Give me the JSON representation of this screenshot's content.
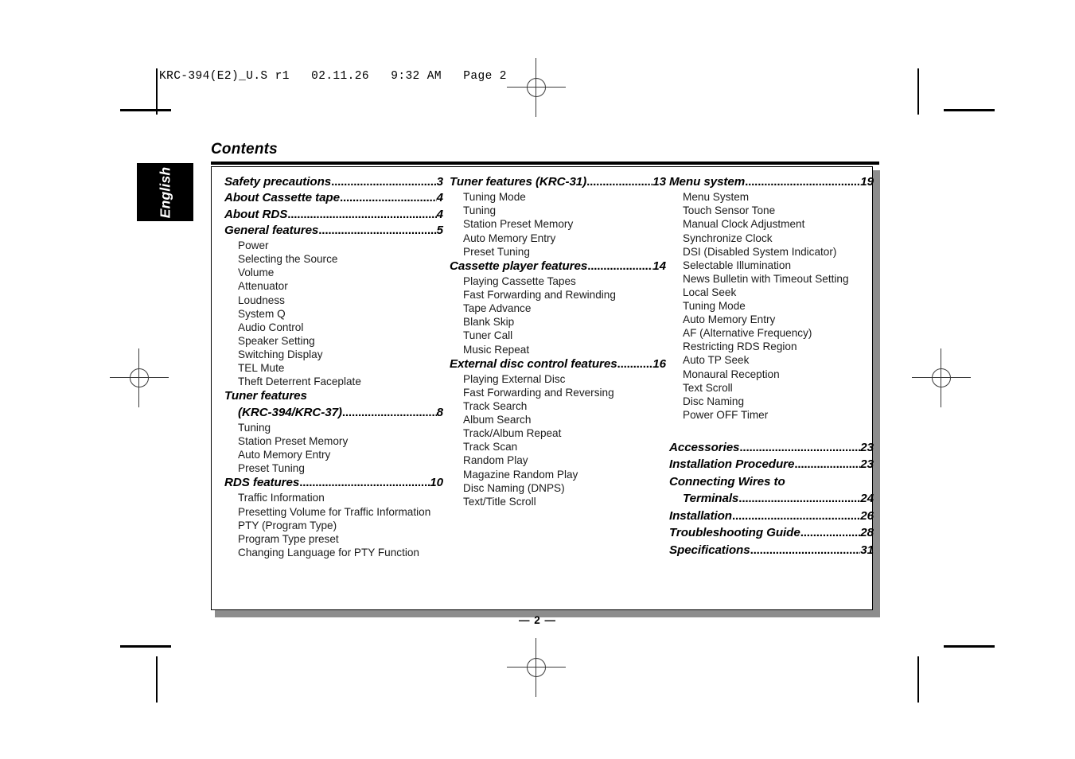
{
  "print_header": {
    "text": "KRC-394(E2)_U.S r1   02.11.26   9:32 AM   Page 2"
  },
  "language_tab": {
    "label": "English"
  },
  "page_title": "Contents",
  "footer": "— 2 —",
  "colors": {
    "frame": "#000000",
    "shadow": "#8d8d8d",
    "tab_background": "#000000",
    "tab_text": "#ffffff"
  },
  "columns": [
    {
      "sections": [
        {
          "title": "Safety precautions",
          "page": "3",
          "subitems": []
        },
        {
          "title": "About Cassette tape",
          "page": "4",
          "subitems": []
        },
        {
          "title": "About RDS",
          "page": "4",
          "subitems": []
        },
        {
          "title": "General features",
          "page": "5",
          "subitems": [
            "Power",
            "Selecting the Source",
            "Volume",
            "Attenuator",
            "Loudness",
            "System Q",
            "Audio Control",
            "Speaker Setting",
            "Switching Display",
            "TEL Mute",
            "Theft Deterrent Faceplate"
          ]
        },
        {
          "title": "Tuner features",
          "title_line2": "(KRC-394/KRC-37)",
          "page": "8",
          "subitems": [
            "Tuning",
            "Station Preset Memory",
            "Auto Memory Entry",
            "Preset Tuning"
          ]
        },
        {
          "title": "RDS features",
          "page": "10",
          "subitems": [
            "Traffic Information",
            "Presetting Volume for Traffic Information",
            "PTY (Program Type)",
            "Program Type preset",
            "Changing Language for PTY Function"
          ]
        }
      ]
    },
    {
      "sections": [
        {
          "title": "Tuner features (KRC-31)",
          "page": "13",
          "subitems": [
            "Tuning Mode",
            "Tuning",
            "Station Preset Memory",
            "Auto Memory Entry",
            "Preset Tuning"
          ]
        },
        {
          "title": "Cassette player features",
          "page": "14",
          "subitems": [
            "Playing Cassette Tapes",
            "Fast Forwarding and Rewinding",
            "Tape Advance",
            "Blank Skip",
            "Tuner Call",
            "Music Repeat"
          ]
        },
        {
          "title": "External disc control features",
          "page": "16",
          "subitems": [
            "Playing External Disc",
            "Fast Forwarding and Reversing",
            "Track Search",
            "Album Search",
            "Track/Album Repeat",
            "Track Scan",
            "Random Play",
            "Magazine Random Play",
            "Disc Naming (DNPS)",
            "Text/Title Scroll"
          ]
        }
      ]
    },
    {
      "sections": [
        {
          "title": "Menu system",
          "page": "19",
          "subitems": [
            "Menu System",
            "Touch Sensor Tone",
            "Manual Clock Adjustment",
            "Synchronize Clock",
            "DSI (Disabled System Indicator)",
            "Selectable Illumination",
            "News Bulletin with Timeout Setting",
            "Local Seek",
            "Tuning Mode",
            "Auto Memory Entry",
            "AF (Alternative Frequency)",
            "Restricting RDS Region",
            "Auto TP Seek",
            "Monaural Reception",
            "Text Scroll",
            "Disc Naming",
            "Power OFF Timer"
          ]
        }
      ],
      "tail_sections": [
        {
          "title": "Accessories",
          "page": "23",
          "subitems": []
        },
        {
          "title": "Installation Procedure",
          "page": "23",
          "subitems": []
        },
        {
          "title": "Connecting Wires to",
          "title_line2": "Terminals",
          "page": "24",
          "subitems": []
        },
        {
          "title": "Installation",
          "page": "26",
          "subitems": []
        },
        {
          "title": "Troubleshooting Guide",
          "page": "28",
          "subitems": []
        },
        {
          "title": "Specifications",
          "page": "31",
          "subitems": []
        }
      ]
    }
  ]
}
